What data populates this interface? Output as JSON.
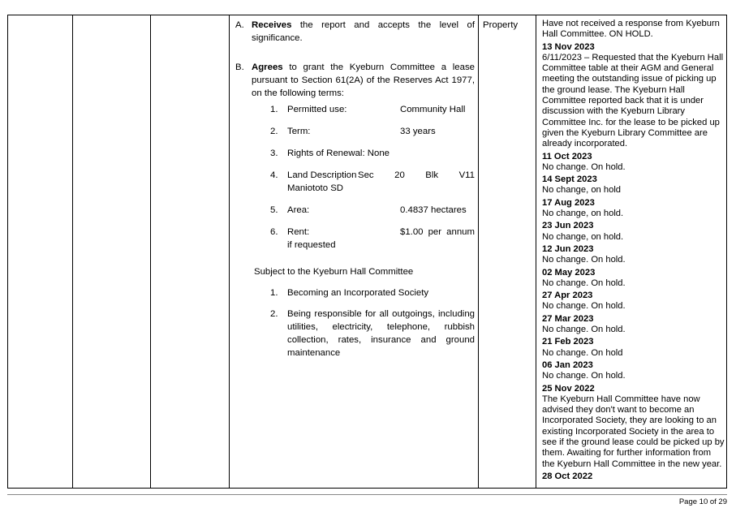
{
  "resolution": {
    "item_a": {
      "tag": "A.",
      "bold": "Receives",
      "rest": " the report and accepts the level of significance."
    },
    "item_b": {
      "tag": "B.",
      "bold": "Agrees",
      "rest": " to grant the Kyeburn Committee a lease pursuant to Section 61(2A) of the Reserves Act 1977, on the following terms:"
    },
    "terms": [
      {
        "num": "1.",
        "label": "Permitted use:",
        "value": "Community Hall"
      },
      {
        "num": "2.",
        "label": "Term:",
        "value": "33 years"
      },
      {
        "num": "3.",
        "label": "Rights of Renewal: None",
        "value": ""
      },
      {
        "num": "4.",
        "label": "Land Description",
        "value": "Sec 20 Blk V11",
        "label2": "Maniototo SD"
      },
      {
        "num": "5.",
        "label": "Area:",
        "value": "0.4837 hectares"
      },
      {
        "num": "6.",
        "label": "Rent:",
        "value": "$1.00 per annum",
        "label2": "if requested"
      }
    ],
    "subject_intro": "Subject to the Kyeburn Hall Committee",
    "conditions": [
      {
        "num": "1.",
        "text": "Becoming an Incorporated Society"
      },
      {
        "num": "2.",
        "text": "Being responsible for all outgoings, including utilities, electricity, telephone, rubbish collection, rates, insurance and ground maintenance"
      }
    ]
  },
  "category": "Property",
  "status_log": {
    "intro": "Have not received a response from Kyeburn Hall Committee.  ON HOLD.",
    "entries": [
      {
        "date": "13 Nov 2023",
        "text": "6/11/2023 – Requested that the Kyeburn Hall Committee table at their AGM and General meeting the outstanding issue of picking up the ground lease.  The Kyeburn Hall Committee reported back that it is under discussion with the Kyeburn Library Committee Inc. for the lease to be picked up given the Kyeburn Library Committee are already incorporated."
      },
      {
        "date": "11 Oct 2023",
        "text": "No change. On hold."
      },
      {
        "date": "14 Sept 2023",
        "text": "No change, on hold"
      },
      {
        "date": "17 Aug 2023",
        "text": "No change, on hold."
      },
      {
        "date": "23 Jun 2023",
        "text": "No change, on hold."
      },
      {
        "date": "12 Jun 2023",
        "text": "No change. On hold."
      },
      {
        "date": "02 May 2023",
        "text": "No change. On hold."
      },
      {
        "date": "27 Apr 2023",
        "text": "No change. On hold."
      },
      {
        "date": "27 Mar 2023",
        "text": "No change.  On hold."
      },
      {
        "date": "21 Feb 2023",
        "text": "No change.  On hold"
      },
      {
        "date": "06 Jan 2023",
        "text": "No change. On hold."
      },
      {
        "date": "25 Nov 2022",
        "text": "The Kyeburn Hall Committee have now advised they don't want to become an Incorporated Society, they are looking to an existing Incorporated Society in the area to see if the ground lease could be picked up by them.  Awaiting for further information from the Kyeburn Hall Committee in the new year."
      },
      {
        "date": "28 Oct 2022",
        "text": ""
      }
    ]
  },
  "footer": {
    "page_label": "Page 10 of 29"
  }
}
